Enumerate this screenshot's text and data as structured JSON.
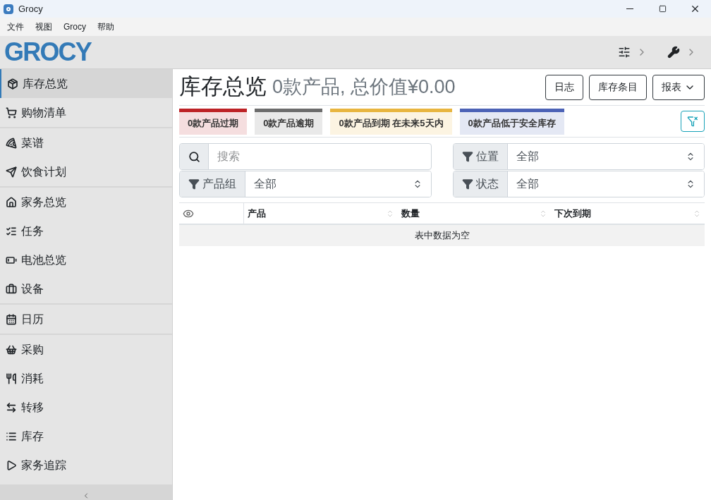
{
  "window": {
    "title": "Grocy"
  },
  "menu": [
    "文件",
    "视图",
    "Grocy",
    "帮助"
  ],
  "logo": "GROCY",
  "sidebar": {
    "sections": [
      [
        {
          "label": "库存总览",
          "selected": true
        },
        {
          "label": "购物清单",
          "selected": false
        }
      ],
      [
        {
          "label": "菜谱",
          "selected": false
        },
        {
          "label": "饮食计划",
          "selected": false
        }
      ],
      [
        {
          "label": "家务总览",
          "selected": false
        },
        {
          "label": "任务",
          "selected": false
        },
        {
          "label": "电池总览",
          "selected": false
        },
        {
          "label": "设备",
          "selected": false
        }
      ],
      [
        {
          "label": "日历",
          "selected": false
        }
      ],
      [
        {
          "label": "采购",
          "selected": false
        },
        {
          "label": "消耗",
          "selected": false
        },
        {
          "label": "转移",
          "selected": false
        },
        {
          "label": "库存",
          "selected": false
        },
        {
          "label": "家务追踪",
          "selected": false
        }
      ]
    ]
  },
  "page": {
    "title": "库存总览",
    "subtitle": "0款产品, 总价值¥0.00",
    "buttons": [
      {
        "label": "日志",
        "kind": "plain"
      },
      {
        "label": "库存条目",
        "kind": "plain"
      },
      {
        "label": "报表",
        "kind": "dropdown"
      }
    ]
  },
  "alerts": [
    {
      "text": "0款产品过期",
      "color": "#bd2226"
    },
    {
      "text": "0款产品逾期",
      "color": "#6c6c6c"
    },
    {
      "text": "0款产品到期 在未来5天内",
      "color": "#e8b53f"
    },
    {
      "text": "0款产品低于安全库存",
      "color": "#4c62b6"
    }
  ],
  "filters": {
    "search": {
      "placeholder": "搜索"
    },
    "location": {
      "label": "位置",
      "value": "全部"
    },
    "product_group": {
      "label": "产品组",
      "value": "全部"
    },
    "status": {
      "label": "状态",
      "value": "全部"
    }
  },
  "table": {
    "columns": [
      "产品",
      "数量",
      "下次到期"
    ],
    "empty_message": "表中数据为空"
  }
}
